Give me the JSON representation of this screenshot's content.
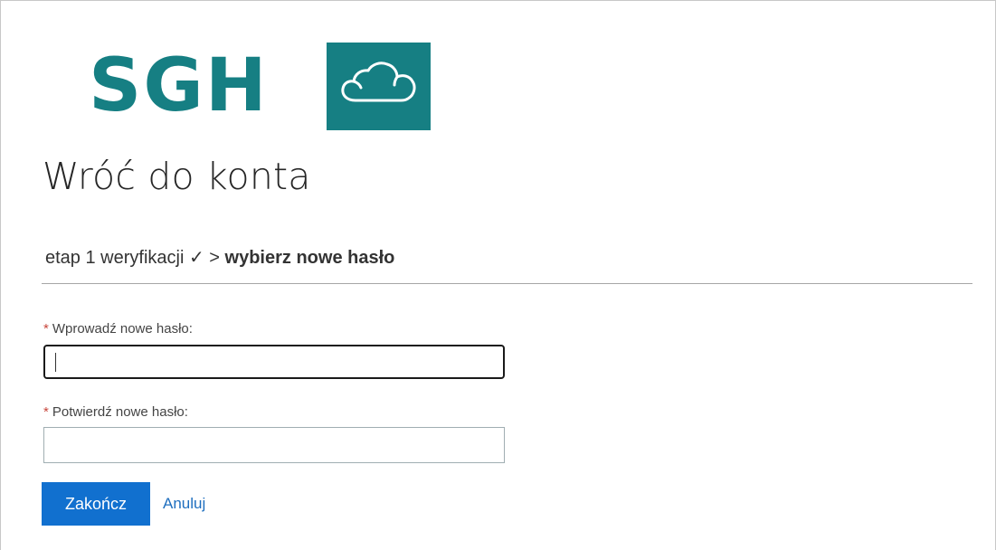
{
  "logo": {
    "text": "SGH",
    "icon": "cloud-icon",
    "brand_color": "#167f83"
  },
  "title": "Wróć do konta",
  "breadcrumb": {
    "step1": "etap 1 weryfikacji ✓",
    "separator": ">",
    "current": "wybierz nowe hasło"
  },
  "form": {
    "required_mark": "*",
    "new_password_label": "Wprowadź nowe hasło:",
    "new_password_value": "",
    "confirm_password_label": "Potwierdź nowe hasło:",
    "confirm_password_value": ""
  },
  "actions": {
    "finish_label": "Zakończ",
    "cancel_label": "Anuluj",
    "primary_color": "#1170cf"
  }
}
